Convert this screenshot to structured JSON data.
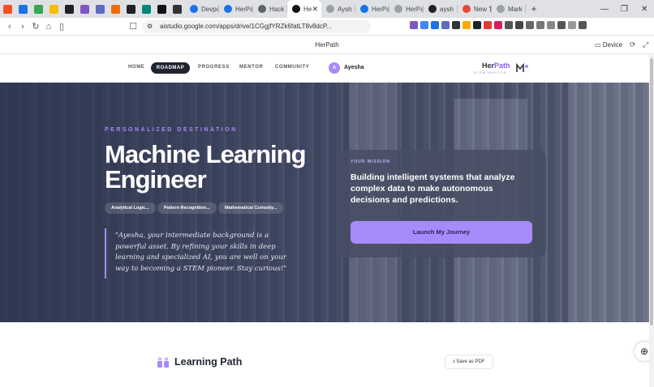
{
  "browser": {
    "tabs": [
      {
        "label": "Devpo",
        "color": "#1a73e8"
      },
      {
        "label": "HerPa",
        "color": "#1a73e8"
      },
      {
        "label": "Hack I",
        "color": "#5f6368"
      },
      {
        "label": "He",
        "color": "#111111"
      },
      {
        "label": "Aysh",
        "color": "#9aa0a6"
      },
      {
        "label": "HerPa",
        "color": "#1a73e8"
      },
      {
        "label": "HerPa",
        "color": "#9aa0a6"
      },
      {
        "label": "aysh",
        "color": "#222222"
      },
      {
        "label": "New T",
        "color": "#e8453c"
      },
      {
        "label": "Mark",
        "color": "#9aa0a6"
      }
    ],
    "new_tab_label": "+",
    "window_controls": {
      "minimize": "—",
      "restore": "❐",
      "close": "✕"
    },
    "url": "aistudio.google.com/apps/drive/1CGgjfYRZk6fatLT8v8dcP...",
    "pinned_colors": [
      "#f4511e",
      "#1a73e8",
      "#34a853",
      "#fbbc04",
      "#202124",
      "#7e57c2",
      "#5c6bc0",
      "#ef6c00",
      "#202124",
      "#00897b",
      "#111111",
      "#333333"
    ]
  },
  "studio": {
    "title": "HerPath",
    "device_label": "Device"
  },
  "app_nav": {
    "links": [
      {
        "label": "HOME"
      },
      {
        "label": "ROADMAP",
        "active": true
      },
      {
        "label": "PROGRESS"
      },
      {
        "label": "MENTOR"
      },
      {
        "label": "COMMUNITY"
      }
    ],
    "avatar_initial": "A",
    "user_name": "Ayesha",
    "logo_her": "Her",
    "logo_path": "Path",
    "logo_sub": "STEM MENTOR"
  },
  "hero": {
    "eyebrow": "PERSONALIZED DESTINATION",
    "title": "Machine Learning Engineer",
    "chips": [
      "Analytical Logic...",
      "Pattern Recognition...",
      "Mathematical Curiosity..."
    ],
    "quote": "\"Ayesha, your intermediate background is a powerful asset. By refining your skills in deep learning and specialized AI, you are well on your way to becoming a STEM pioneer. Stay curious!\""
  },
  "mission": {
    "eyebrow": "YOUR MISSION",
    "text": "Building intelligent systems that analyze complex data to make autonomous decisions and predictions.",
    "button": "Launch My Journey"
  },
  "learning_path": {
    "title": "Learning Path",
    "save_pdf": "Save as PDF"
  },
  "colors": {
    "accent": "#a78bfa",
    "dark": "#1f2430"
  }
}
